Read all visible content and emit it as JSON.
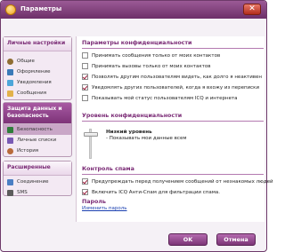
{
  "window": {
    "title": "Параметры"
  },
  "sidebar": {
    "groups": [
      {
        "title": "Личные настройки",
        "items": [
          {
            "label": "Общие",
            "icon": "gear-icon"
          },
          {
            "label": "Оформление",
            "icon": "palette-icon"
          },
          {
            "label": "Уведомления",
            "icon": "bell-icon"
          },
          {
            "label": "Сообщения",
            "icon": "envelope-icon"
          }
        ]
      },
      {
        "title": "Защита данных и безопасность",
        "items": [
          {
            "label": "Безопасность",
            "icon": "lock-icon"
          },
          {
            "label": "Личные списки",
            "icon": "list-icon"
          },
          {
            "label": "История",
            "icon": "clock-icon"
          }
        ]
      },
      {
        "title": "Расширенные",
        "items": [
          {
            "label": "Соединение",
            "icon": "network-icon"
          },
          {
            "label": "SMS",
            "icon": "phone-icon"
          }
        ]
      }
    ]
  },
  "privacy": {
    "title": "Параметры конфиденциальности",
    "options": [
      {
        "label": "Принимать сообщения только от моих контактов",
        "checked": false
      },
      {
        "label": "Принимать вызовы только от моих контактов",
        "checked": false
      },
      {
        "label": "Позволять другим пользователям видеть, как долго я неактивен",
        "checked": true
      },
      {
        "label": "Уведомлять других пользователей, когда я вхожу из переписки",
        "checked": true
      },
      {
        "label": "Показывать мой статус пользователям ICQ и интернета",
        "checked": false
      }
    ]
  },
  "privacy_level": {
    "title": "Уровень конфиденциальности",
    "level_title": "Низкий уровень",
    "level_desc": "- Показывать мои данные всем",
    "level_value": "low"
  },
  "spam": {
    "title": "Контроль спама",
    "options": [
      {
        "label": "Предупреждать перед получением сообщений от незнакомых людей",
        "checked": true
      },
      {
        "label": "Включить ICQ Анти-Спам для фильтрации спама.",
        "checked": true
      }
    ]
  },
  "password": {
    "title": "Пароль",
    "change_link": "Изменить пароль"
  },
  "footer": {
    "ok": "OK",
    "cancel": "Отмена"
  },
  "colors": {
    "accent": "#7a2a75",
    "link": "#1a3fb0"
  }
}
